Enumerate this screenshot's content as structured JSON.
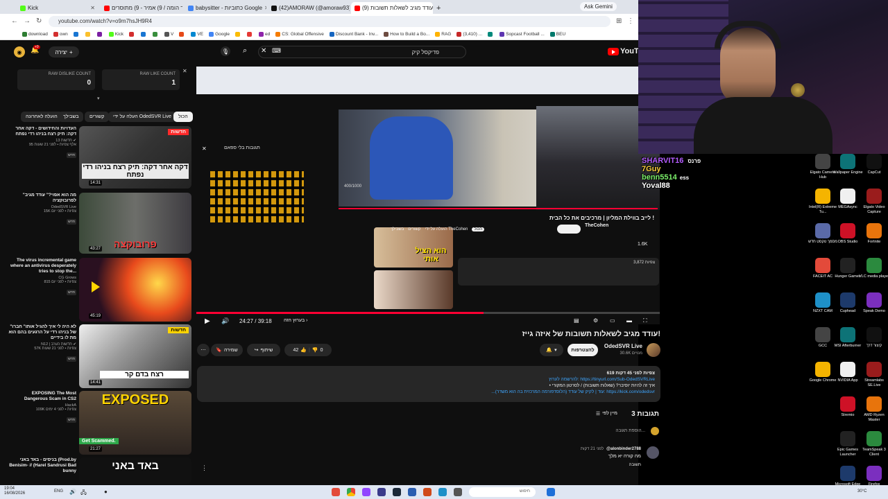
{
  "browser": {
    "tabs": [
      {
        "title": "Kick",
        "color": "#53fc18"
      },
      {
        "title": "אבסורד הומה / 9) אמיר - 9) מתוסרים",
        "color": "#ff0000"
      },
      {
        "title": "babysitter - כתוביות Google",
        "color": "#4285f4"
      },
      {
        "title": "(42)AMORAW (@amoraw93)",
        "color": "#111111"
      },
      {
        "title": "(9) עודד מגיב לשאלות תשובות - ...",
        "color": "#ff0000",
        "active": true
      }
    ],
    "new_tab": "+",
    "gemini": "Ask Gemini",
    "url": "youtube.com/watch?v=o9m7hsJH9R4",
    "bookmarks": [
      "download",
      "own",
      "",
      "",
      "",
      "Kick",
      "",
      "",
      "",
      "V",
      "",
      "VE",
      "Google",
      "",
      "",
      "ed",
      "CS: Global Offensive",
      "Discount Bank - Inv...",
      "How to Build a Bo...",
      "RAG",
      "(3,410) ...",
      "",
      "Sopcast Football ...",
      "BEU"
    ],
    "window_controls": [
      "—",
      "▢",
      "✕"
    ]
  },
  "youtube": {
    "logo": "YouTube",
    "search_value": "פדיקסל קיק",
    "create_label": "יצירה",
    "notif_badge": "+9",
    "raw_dislike_label": "RAW DISLIKE COUNT",
    "raw_dislike_value": "0",
    "raw_like_label": "RAW LIKE COUNT",
    "raw_like_value": "1",
    "chips": [
      "הכול",
      "העלה על ידי OdedSVR Live",
      "קשורים",
      "בשבילך",
      "הועלה לאחרונה"
    ],
    "recommendations": [
      {
        "title": "העדויות והחידושים - דקה אחר דקה: תיק רצח בניהו רדי נפתח",
        "channel": "חדשות 13 ✔",
        "stats": "95 אלף צפיות • לפני 21 שעות",
        "badge": "חדש",
        "duration": "14:31",
        "caption": "דקה אחר דקה: תיק רצח בניהו רדי נפתח",
        "tag": "חדשות"
      },
      {
        "title": "\"מה הוא אפוי?\" עודד מגיב לפרובוקציה",
        "channel": "OdedSVR Live",
        "stats": "15K צפיות • לפני יום",
        "badge": "חדש",
        "duration": "43:27",
        "caption": "פרובוקצה"
      },
      {
        "title": "The virus incremental game where an antivirus desperately tries to stop the...",
        "channel": "CG Grows",
        "stats": "815 צפיות • לפני יום",
        "badge": "חדש",
        "duration": "45:19",
        "caption": ""
      },
      {
        "title": "\"לא היה לי איך להגיל אותו\" חברו של בניהו רדי על הרגעים בהם הוא מת לו בידיים",
        "channel": "N12 | חדשות הערב ✔",
        "stats": "57K צפיות • לפני 21 שעות",
        "badge": "חדש",
        "duration": "14:41",
        "caption": "רצח בדם קר",
        "tag": "חדשות"
      },
      {
        "title": "EXPOSING The Most Dangerous Scam in CS2",
        "channel": "HackA",
        "stats": "109K צפיות • לפני 4 ימים",
        "badge": "חדש",
        "duration": "21:27",
        "caption": "EXPOSED",
        "sub": "Get Scammed."
      },
      {
        "title": "בניסים - באד באני (Prod.by Benisim- // (Harel Sandrusi Bad bunny",
        "channel": "",
        "stats": "",
        "badge": "",
        "duration": "",
        "caption": "באד באני"
      }
    ],
    "video": {
      "title": "עודד מגיב לשאלות תשובות של איזה גייז!",
      "channel": "OdedSVR Live",
      "subs": "30.6K מנויים",
      "subscribe_label": "להצטרפות",
      "likes": "42",
      "dislikes": "0",
      "share_label": "שיתוף",
      "save_label": "שמירה",
      "time": "24:27 / 39:18",
      "progress": 0.62,
      "chapter": "בערוץ הזה ›",
      "description_line1": "619 צפיות  לפני 45 דקות",
      "description_line2": "להרשמה לערוץ: https://tinyurl.com/Sub-OdedSVRLive",
      "description_line3": "• איך זה להיות יוסיבר? (שאלות תשובות) / לסרטון המקורי",
      "description_line4": "...עוד  | לקיק של עודד (הלוסדפורמה המרכזית בה הוא משדר): https://kick.com/odedsvr"
    },
    "comments": {
      "count_label": "3 תגובות",
      "sort_label": "מיין לפי",
      "add_placeholder": "הוספת תגובה...",
      "first_author": "@alonbinder2788",
      "first_time": "לפני 21 דקות",
      "first_text": "מה קורה יא מלך",
      "reply_label": "תשובה"
    },
    "inner": {
      "chat_title": "תגובות בלי ספאם",
      "video_title": "לייב בווילת המליון | מרכיבים את כל הבית !",
      "channel": "TheCohen",
      "chips": [
        "הכול",
        "הועלה על ידי TheCohen",
        "קשורים",
        "בשבילך"
      ],
      "views": "3,872 צפיות",
      "likes": "1.6K",
      "time": "400/1000",
      "rec_time1": "18:29",
      "rec_time2": "41:25",
      "rec_caption1": "הוא הציל אותי"
    }
  },
  "overlay": {
    "chat": [
      {
        "name": "SHARVIT16",
        "text": "פרנס",
        "color": "#b45cff"
      },
      {
        "name": "7Guy",
        "text": "",
        "color": "#ffd23f"
      },
      {
        "name": "benn5514",
        "text": "ess",
        "color": "#7cf06b"
      },
      {
        "name": "Yoval88",
        "text": "",
        "color": "#ffffff"
      }
    ]
  },
  "desktop_icons": [
    [
      "CapCut",
      "Wallpaper Engine",
      "Elgato Camera Hub"
    ],
    [
      "Elgato Video Capture",
      "MEGAsync",
      "Intel(R) Extreme Tu..."
    ],
    [
      "Fortnite",
      "OBS Studio",
      "מסמך טקסט חדש"
    ],
    [
      "VLC media player",
      "Hunger Games",
      "FACEIT AC"
    ],
    [
      "Speak Demo",
      "Cuphead",
      "NZXT CAM"
    ],
    [
      "קיצור דרך",
      "MSI Afterburner",
      "GCC"
    ],
    [
      "Streamlabs SE.Live",
      "NVIDIA App",
      "Google Chrome"
    ],
    [
      "AMD Ryzen Master",
      "Stremio",
      ""
    ],
    [
      "TeamSpeak 3 Client",
      "Epic Games Launcher",
      ""
    ],
    [
      "Firefox",
      "Microsoft Edge",
      ""
    ]
  ],
  "taskbar": {
    "time": "19:04",
    "date": "16/08/2026",
    "lang": "ENG",
    "weather": "30°C",
    "search_placeholder": "חיפוש"
  }
}
